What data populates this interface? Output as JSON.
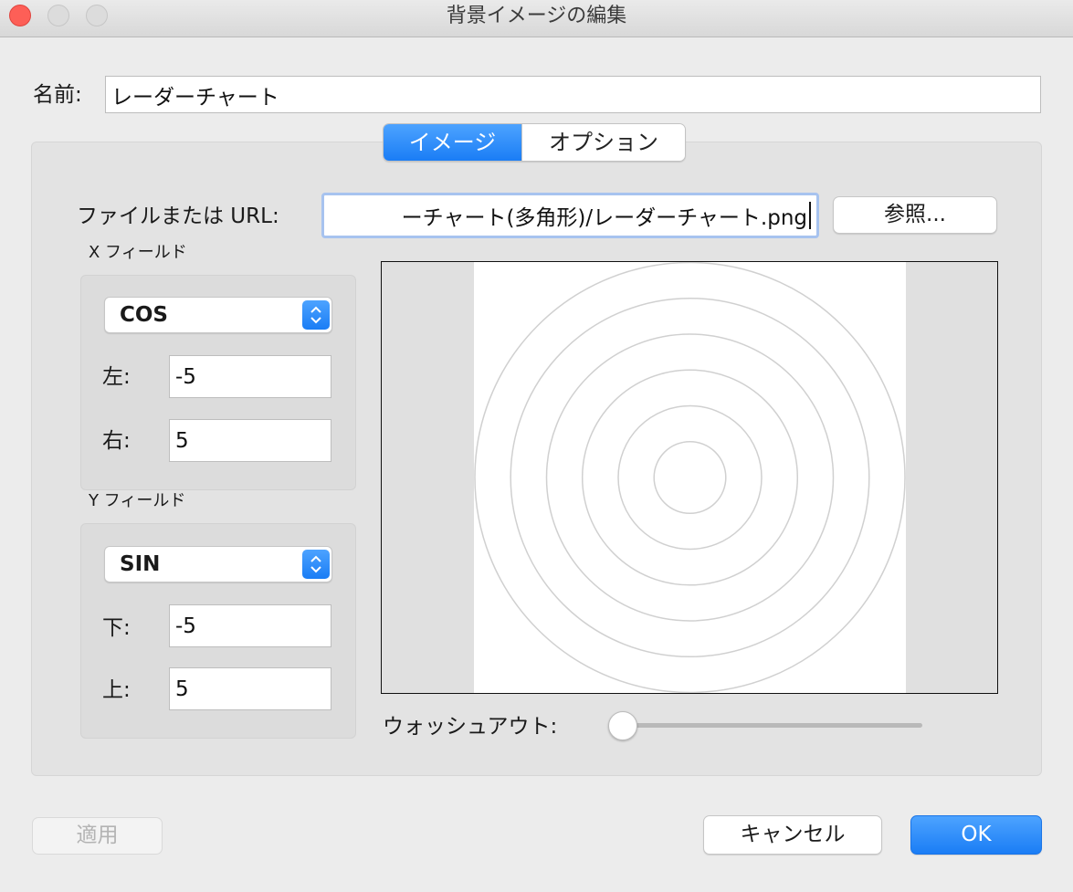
{
  "window": {
    "title": "背景イメージの編集",
    "colors": {
      "close": "#fd5f57",
      "accent": "#1a7df5"
    }
  },
  "name": {
    "label": "名前:",
    "value": "レーダーチャート"
  },
  "tabs": [
    {
      "label": "イメージ",
      "active": true
    },
    {
      "label": "オプション",
      "active": false
    }
  ],
  "file": {
    "label": "ファイルまたは URL:",
    "value": "ーチャート(多角形)/レーダーチャート.png",
    "browse_label": "参照..."
  },
  "x_field": {
    "label": "X フィールド",
    "selected": "COS",
    "left_label": "左:",
    "left_value": "-5",
    "right_label": "右:",
    "right_value": "5"
  },
  "y_field": {
    "label": "Y フィールド",
    "selected": "SIN",
    "bottom_label": "下:",
    "bottom_value": "-5",
    "top_label": "上:",
    "top_value": "5"
  },
  "preview": {
    "ring_count": 6
  },
  "washout": {
    "label": "ウォッシュアウト:",
    "value": 0
  },
  "buttons": {
    "apply": "適用",
    "cancel": "キャンセル",
    "ok": "OK"
  }
}
